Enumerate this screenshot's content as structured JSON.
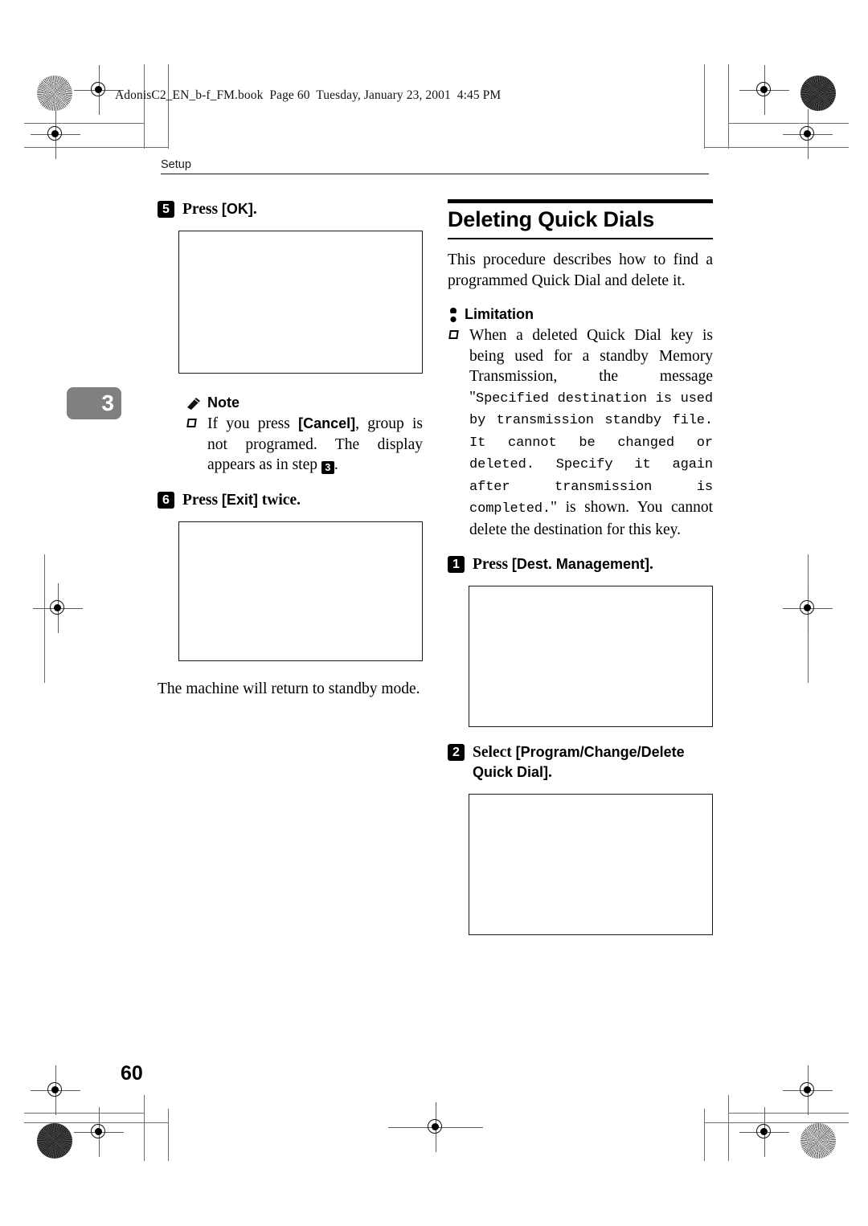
{
  "document": {
    "file_header": "AdonisC2_EN_b-f_FM.book  Page 60  Tuesday, January 23, 2001  4:45 PM",
    "running_head": "Setup",
    "chapter_tab": "3",
    "page_number": "60"
  },
  "left_column": {
    "step5": {
      "number": "5",
      "text_pre": "Press ",
      "key": "[OK]",
      "text_post": "."
    },
    "note": {
      "title": "Note",
      "icon": "pencil-icon",
      "bullet": {
        "part1": "If you press ",
        "key": "[Cancel]",
        "part2": ", group is not programed. The display appears as in step ",
        "step_ref": "3",
        "part3": "."
      }
    },
    "step6": {
      "number": "6",
      "text_pre": "Press ",
      "key": "[Exit]",
      "text_post": " twice."
    },
    "closing_text": "The machine will return to standby mode."
  },
  "right_column": {
    "section_title": "Deleting Quick Dials",
    "intro": "This procedure describes how to find a programmed Quick Dial and delete it.",
    "limitation": {
      "title": "Limitation",
      "icon": "bulb-icon",
      "bullet": {
        "part1": "When a deleted Quick Dial key is being used for a standby Memory Transmission, the message \"",
        "message": "Specified destination is used by transmission standby file. It cannot be changed or deleted. Specify it again after transmission is completed.",
        "part2": "\" is shown. You cannot delete the destination for this key."
      }
    },
    "step1": {
      "number": "1",
      "text_pre": "Press ",
      "key": "[Dest. Management]",
      "text_post": "."
    },
    "step2": {
      "number": "2",
      "text_pre": "Select ",
      "key": "[Program/Change/Delete Quick Dial]",
      "text_post": "."
    }
  },
  "colors": {
    "chapter_tab_background": "#808080",
    "text": "#000000",
    "rule": "#000000"
  }
}
